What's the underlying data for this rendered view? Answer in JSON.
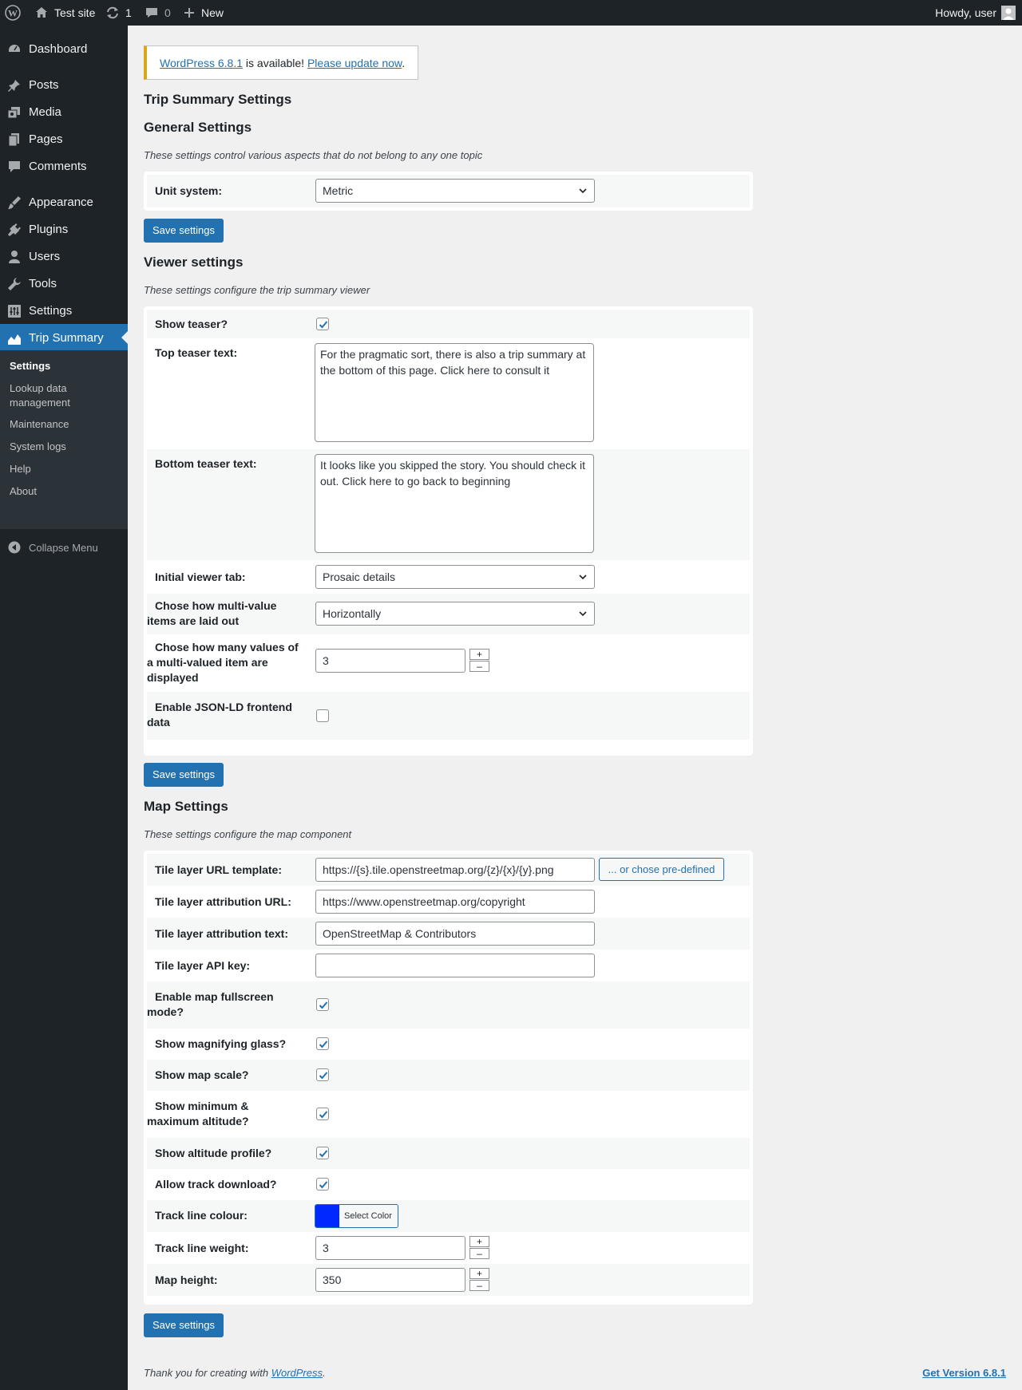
{
  "adminbar": {
    "site_name": "Test site",
    "updates_count": "1",
    "comments_count": "0",
    "new_label": "New",
    "howdy": "Howdy, user"
  },
  "sidebar": {
    "items": [
      {
        "label": "Dashboard",
        "icon": "dashboard-icon"
      },
      {
        "label": "Posts",
        "icon": "pin-icon"
      },
      {
        "label": "Media",
        "icon": "media-icon"
      },
      {
        "label": "Pages",
        "icon": "pages-icon"
      },
      {
        "label": "Comments",
        "icon": "comment-icon"
      },
      {
        "label": "Appearance",
        "icon": "brush-icon"
      },
      {
        "label": "Plugins",
        "icon": "plug-icon"
      },
      {
        "label": "Users",
        "icon": "user-icon"
      },
      {
        "label": "Tools",
        "icon": "wrench-icon"
      },
      {
        "label": "Settings",
        "icon": "settings-icon"
      },
      {
        "label": "Trip Summary",
        "icon": "chart-area-icon"
      }
    ],
    "submenu": [
      "Settings",
      "Lookup data management",
      "Maintenance",
      "System logs",
      "Help",
      "About"
    ],
    "collapse": "Collapse Menu"
  },
  "notice": {
    "link1": "WordPress 6.8.1",
    "text": " is available! ",
    "link2": "Please update now",
    "end": "."
  },
  "page_title": "Trip Summary Settings",
  "general": {
    "title": "General Settings",
    "desc": "These settings control various aspects that do not belong to any one topic",
    "unit_label": "Unit system:",
    "unit_value": "Metric",
    "save": "Save settings"
  },
  "viewer": {
    "title": "Viewer settings",
    "desc": "These settings configure the trip summary viewer",
    "show_teaser_label": "Show teaser?",
    "show_teaser": true,
    "top_teaser_label": "Top teaser text:",
    "top_teaser_text": "For the pragmatic sort, there is also a trip summary at the bottom of this page. Click here to consult it",
    "bottom_teaser_label": "Bottom teaser text:",
    "bottom_teaser_text": "It looks like you skipped the story. You should check it out. Click here to go back to beginning",
    "initial_tab_label": "Initial viewer tab:",
    "initial_tab_value": "Prosaic details",
    "layout_label": "Chose how multi-value items are laid out",
    "layout_value": "Horizontally",
    "count_label": "Chose how many values of a multi-valued item are displayed",
    "count_value": "3",
    "jsonld_label": "Enable JSON-LD frontend data",
    "jsonld": false,
    "save": "Save settings"
  },
  "map": {
    "title": "Map Settings",
    "desc": "These settings configure the map component",
    "tile_url_label": "Tile layer URL template:",
    "tile_url_value": "https://{s}.tile.openstreetmap.org/{z}/{x}/{y}.png",
    "predefined_button": "... or chose pre-defined",
    "attr_url_label": "Tile layer attribution URL:",
    "attr_url_value": "https://www.openstreetmap.org/copyright",
    "attr_text_label": "Tile layer attribution text:",
    "attr_text_value": "OpenStreetMap & Contributors",
    "api_key_label": "Tile layer API key:",
    "api_key_value": "",
    "fullscreen_label": "Enable map fullscreen mode?",
    "magnify_label": "Show magnifying glass?",
    "scale_label": "Show map scale?",
    "minmax_label": "Show minimum & maximum altitude?",
    "altitude_label": "Show altitude profile?",
    "download_label": "Allow track download?",
    "checks": [
      true,
      true,
      true,
      true,
      true,
      true
    ],
    "track_colour_label": "Track line colour:",
    "track_colour": "#0028ff",
    "select_color": "Select Color",
    "track_weight_label": "Track line weight:",
    "track_weight_value": "3",
    "map_height_label": "Map height:",
    "map_height_value": "350",
    "save": "Save settings"
  },
  "footer": {
    "text_before": "Thank you for creating with ",
    "link": "WordPress",
    "text_after": ".",
    "version": "Get Version 6.8.1"
  },
  "colors": {
    "accent": "#2271b1",
    "admin_bg": "#1d2327",
    "notice_warning": "#dba617"
  }
}
